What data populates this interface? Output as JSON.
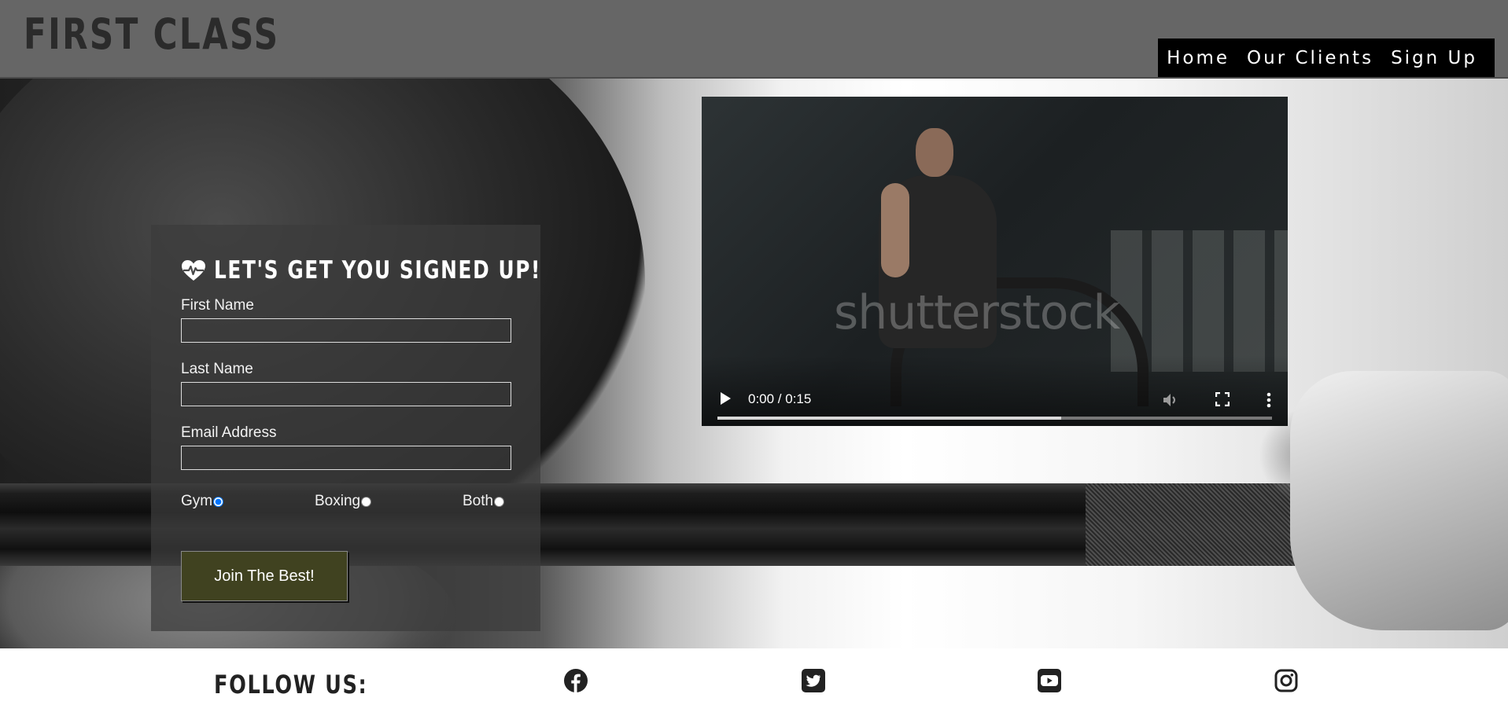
{
  "brand": "FIRST CLASS",
  "nav": [
    {
      "label": "Home"
    },
    {
      "label": "Our Clients"
    },
    {
      "label": "Sign Up"
    }
  ],
  "form": {
    "title": "LET'S GET YOU SIGNED UP!",
    "fields": [
      {
        "label": "First Name",
        "value": ""
      },
      {
        "label": "Last Name",
        "value": ""
      },
      {
        "label": "Email Address",
        "value": ""
      }
    ],
    "radios": [
      {
        "label": "Gym",
        "checked": true
      },
      {
        "label": "Boxing",
        "checked": false
      },
      {
        "label": "Both",
        "checked": false
      }
    ],
    "submit_label": "Join The Best!"
  },
  "video": {
    "time": "0:00 / 0:15",
    "watermark": "shutterstock",
    "buffered_fraction": 0.62
  },
  "footer": {
    "follow_label": "FOLLOW US:",
    "socials": [
      "facebook-icon",
      "twitter-icon",
      "youtube-icon",
      "instagram-icon"
    ]
  },
  "colors": {
    "header_bg": "#666666",
    "nav_bg": "#000000",
    "button_bg": "#404220",
    "form_panel": "rgba(60,60,60,0.72)"
  }
}
